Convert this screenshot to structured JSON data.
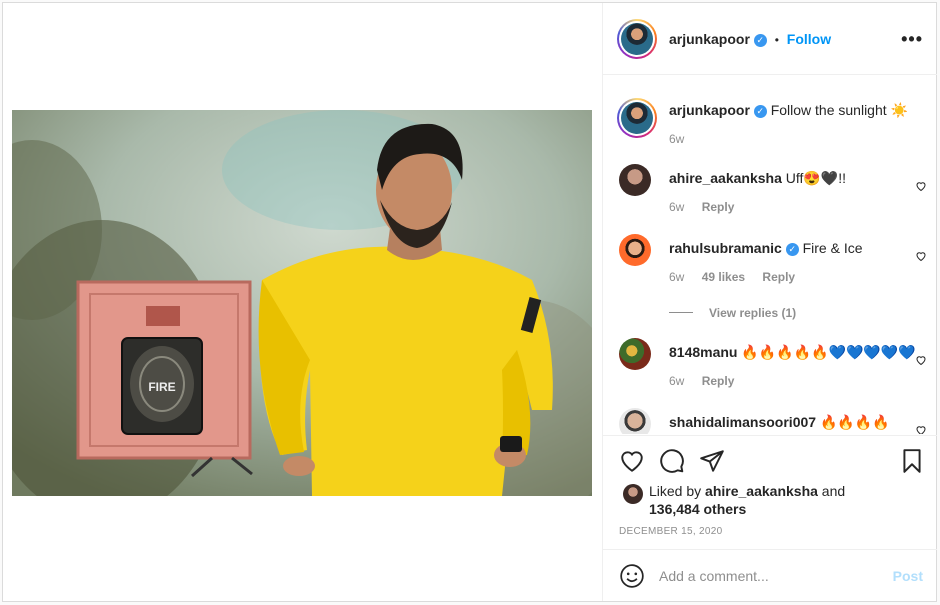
{
  "header": {
    "username": "arjunkapoor",
    "separator": "•",
    "follow_label": "Follow",
    "more_label": "•••"
  },
  "caption": {
    "username": "arjunkapoor",
    "text": "Follow the sunlight ☀️",
    "time": "6w"
  },
  "comments": [
    {
      "username": "ahire_aakanksha",
      "text": "Uff😍🖤!!",
      "time": "6w",
      "likes": "",
      "reply": "Reply"
    },
    {
      "username": "rahulsubramanic",
      "verified": true,
      "text": "Fire & Ice",
      "time": "6w",
      "likes": "49 likes",
      "reply": "Reply",
      "view_replies": "View replies (1)"
    },
    {
      "username": "8148manu",
      "text": "🔥🔥🔥🔥🔥💙💙💙💙💙",
      "time": "6w",
      "likes": "",
      "reply": "Reply"
    },
    {
      "username": "shahidalimansoori007",
      "text": "🔥🔥🔥🔥",
      "time": "",
      "likes": "",
      "reply": ""
    }
  ],
  "photo": {
    "sign_text": "FIRE"
  },
  "likes": {
    "prefix": "Liked by",
    "user": "ahire_aakanksha",
    "conj": "and",
    "count": "136,484 others"
  },
  "date": "DECEMBER 15, 2020",
  "composer": {
    "placeholder": "Add a comment...",
    "post_label": "Post"
  },
  "colors": {
    "accent": "#0095f6",
    "verified": "#3897f0",
    "post_disabled": "#b2dffc",
    "sweater": "#f5d21a"
  },
  "icons": [
    "more-icon",
    "verified-icon",
    "heart-icon",
    "comment-icon",
    "share-icon",
    "bookmark-icon",
    "emoji-icon"
  ]
}
